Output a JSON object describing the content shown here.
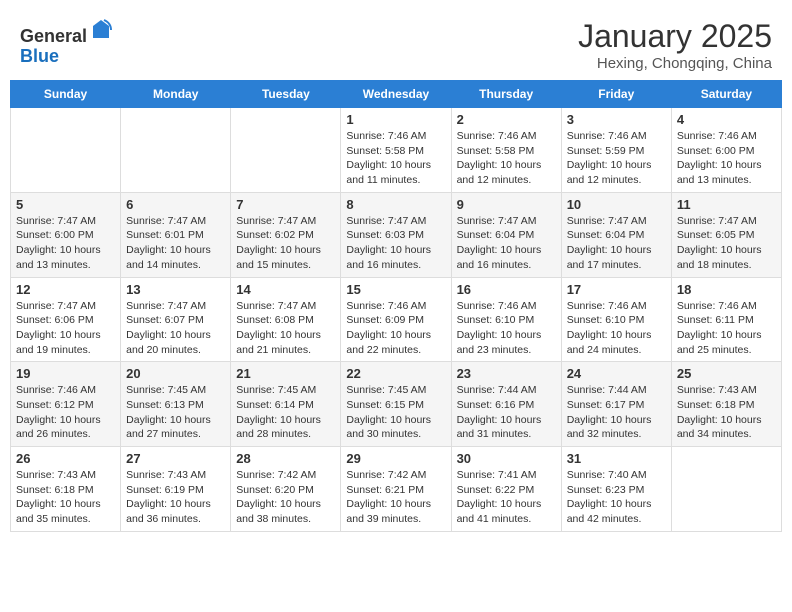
{
  "header": {
    "logo_line1": "General",
    "logo_line2": "Blue",
    "month_title": "January 2025",
    "location": "Hexing, Chongqing, China"
  },
  "weekdays": [
    "Sunday",
    "Monday",
    "Tuesday",
    "Wednesday",
    "Thursday",
    "Friday",
    "Saturday"
  ],
  "weeks": [
    [
      {
        "day": "",
        "info": ""
      },
      {
        "day": "",
        "info": ""
      },
      {
        "day": "",
        "info": ""
      },
      {
        "day": "1",
        "info": "Sunrise: 7:46 AM\nSunset: 5:58 PM\nDaylight: 10 hours and 11 minutes."
      },
      {
        "day": "2",
        "info": "Sunrise: 7:46 AM\nSunset: 5:58 PM\nDaylight: 10 hours and 12 minutes."
      },
      {
        "day": "3",
        "info": "Sunrise: 7:46 AM\nSunset: 5:59 PM\nDaylight: 10 hours and 12 minutes."
      },
      {
        "day": "4",
        "info": "Sunrise: 7:46 AM\nSunset: 6:00 PM\nDaylight: 10 hours and 13 minutes."
      }
    ],
    [
      {
        "day": "5",
        "info": "Sunrise: 7:47 AM\nSunset: 6:00 PM\nDaylight: 10 hours and 13 minutes."
      },
      {
        "day": "6",
        "info": "Sunrise: 7:47 AM\nSunset: 6:01 PM\nDaylight: 10 hours and 14 minutes."
      },
      {
        "day": "7",
        "info": "Sunrise: 7:47 AM\nSunset: 6:02 PM\nDaylight: 10 hours and 15 minutes."
      },
      {
        "day": "8",
        "info": "Sunrise: 7:47 AM\nSunset: 6:03 PM\nDaylight: 10 hours and 16 minutes."
      },
      {
        "day": "9",
        "info": "Sunrise: 7:47 AM\nSunset: 6:04 PM\nDaylight: 10 hours and 16 minutes."
      },
      {
        "day": "10",
        "info": "Sunrise: 7:47 AM\nSunset: 6:04 PM\nDaylight: 10 hours and 17 minutes."
      },
      {
        "day": "11",
        "info": "Sunrise: 7:47 AM\nSunset: 6:05 PM\nDaylight: 10 hours and 18 minutes."
      }
    ],
    [
      {
        "day": "12",
        "info": "Sunrise: 7:47 AM\nSunset: 6:06 PM\nDaylight: 10 hours and 19 minutes."
      },
      {
        "day": "13",
        "info": "Sunrise: 7:47 AM\nSunset: 6:07 PM\nDaylight: 10 hours and 20 minutes."
      },
      {
        "day": "14",
        "info": "Sunrise: 7:47 AM\nSunset: 6:08 PM\nDaylight: 10 hours and 21 minutes."
      },
      {
        "day": "15",
        "info": "Sunrise: 7:46 AM\nSunset: 6:09 PM\nDaylight: 10 hours and 22 minutes."
      },
      {
        "day": "16",
        "info": "Sunrise: 7:46 AM\nSunset: 6:10 PM\nDaylight: 10 hours and 23 minutes."
      },
      {
        "day": "17",
        "info": "Sunrise: 7:46 AM\nSunset: 6:10 PM\nDaylight: 10 hours and 24 minutes."
      },
      {
        "day": "18",
        "info": "Sunrise: 7:46 AM\nSunset: 6:11 PM\nDaylight: 10 hours and 25 minutes."
      }
    ],
    [
      {
        "day": "19",
        "info": "Sunrise: 7:46 AM\nSunset: 6:12 PM\nDaylight: 10 hours and 26 minutes."
      },
      {
        "day": "20",
        "info": "Sunrise: 7:45 AM\nSunset: 6:13 PM\nDaylight: 10 hours and 27 minutes."
      },
      {
        "day": "21",
        "info": "Sunrise: 7:45 AM\nSunset: 6:14 PM\nDaylight: 10 hours and 28 minutes."
      },
      {
        "day": "22",
        "info": "Sunrise: 7:45 AM\nSunset: 6:15 PM\nDaylight: 10 hours and 30 minutes."
      },
      {
        "day": "23",
        "info": "Sunrise: 7:44 AM\nSunset: 6:16 PM\nDaylight: 10 hours and 31 minutes."
      },
      {
        "day": "24",
        "info": "Sunrise: 7:44 AM\nSunset: 6:17 PM\nDaylight: 10 hours and 32 minutes."
      },
      {
        "day": "25",
        "info": "Sunrise: 7:43 AM\nSunset: 6:18 PM\nDaylight: 10 hours and 34 minutes."
      }
    ],
    [
      {
        "day": "26",
        "info": "Sunrise: 7:43 AM\nSunset: 6:18 PM\nDaylight: 10 hours and 35 minutes."
      },
      {
        "day": "27",
        "info": "Sunrise: 7:43 AM\nSunset: 6:19 PM\nDaylight: 10 hours and 36 minutes."
      },
      {
        "day": "28",
        "info": "Sunrise: 7:42 AM\nSunset: 6:20 PM\nDaylight: 10 hours and 38 minutes."
      },
      {
        "day": "29",
        "info": "Sunrise: 7:42 AM\nSunset: 6:21 PM\nDaylight: 10 hours and 39 minutes."
      },
      {
        "day": "30",
        "info": "Sunrise: 7:41 AM\nSunset: 6:22 PM\nDaylight: 10 hours and 41 minutes."
      },
      {
        "day": "31",
        "info": "Sunrise: 7:40 AM\nSunset: 6:23 PM\nDaylight: 10 hours and 42 minutes."
      },
      {
        "day": "",
        "info": ""
      }
    ]
  ]
}
